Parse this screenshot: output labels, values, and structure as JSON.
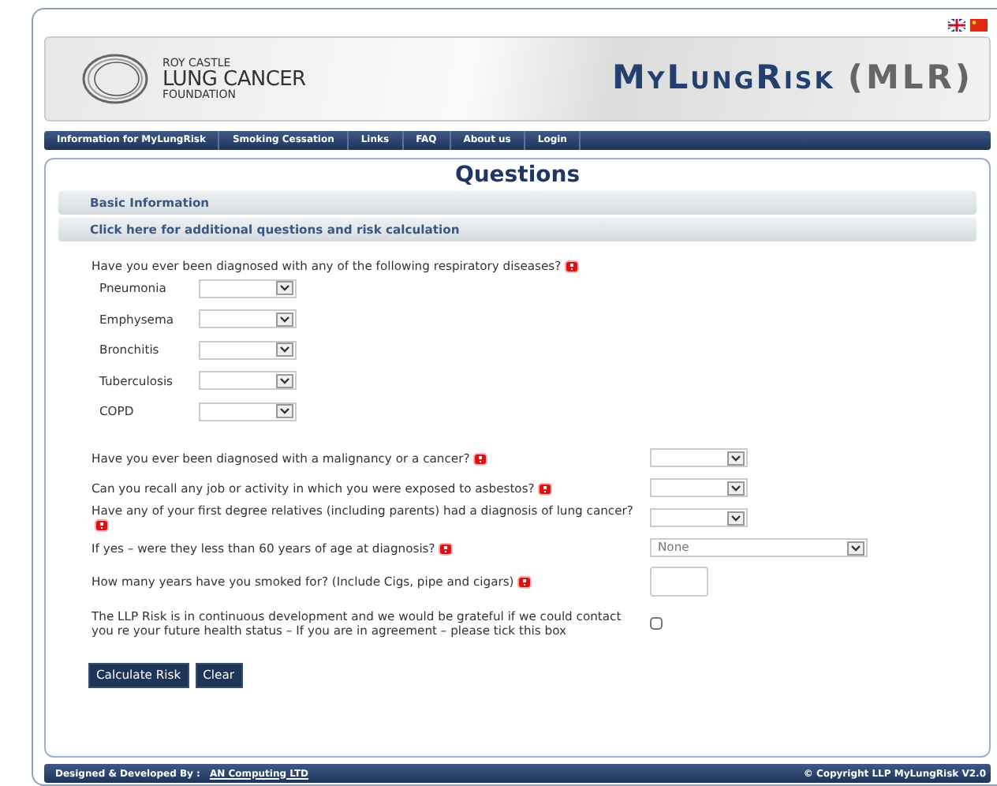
{
  "banner": {
    "org_lines": [
      "ROY CASTLE",
      "LUNG CANCER",
      "FOUNDATION"
    ],
    "title": "MyLungRisk",
    "title_suffix": "(MLR)"
  },
  "nav": [
    "Information for MyLungRisk",
    "Smoking Cessation",
    "Links",
    "FAQ",
    "About us",
    "Login"
  ],
  "heading": "Questions",
  "sections": [
    "Basic Information",
    "Click here for additional questions and risk calculation"
  ],
  "respiratory": {
    "text": "Have you ever been diagnosed with any of the following respiratory diseases?",
    "conditions": [
      "Pneumonia",
      "Emphysema",
      "Bronchitis",
      "Tuberculosis",
      "COPD"
    ]
  },
  "questions": [
    {
      "kind": "select",
      "text": "Have you ever been diagnosed with a malignancy or a cancer?"
    },
    {
      "kind": "select",
      "text": "Can you recall any job or activity in which you were exposed to asbestos?"
    },
    {
      "kind": "select",
      "text": "Have any of your first degree relatives (including parents) had a diagnosis of lung cancer?"
    },
    {
      "kind": "wide-select",
      "text": "If yes – were they less than 60 years of age at diagnosis?",
      "value": "None"
    },
    {
      "kind": "number",
      "text": "How many years have you smoked for? (Include Cigs, pipe and cigars)"
    },
    {
      "kind": "checkbox",
      "text": "The LLP Risk is in continuous development and we would be grateful if we could contact you re your future health status – If you are in agreement – please tick this box",
      "checked": false
    }
  ],
  "buttons": [
    "Calculate Risk",
    "Clear"
  ],
  "footer": {
    "credit": "Designed & Developed By :",
    "link": "AN Computing LTD",
    "copyright": "© Copyright LLP MyLungRisk V2.0"
  }
}
